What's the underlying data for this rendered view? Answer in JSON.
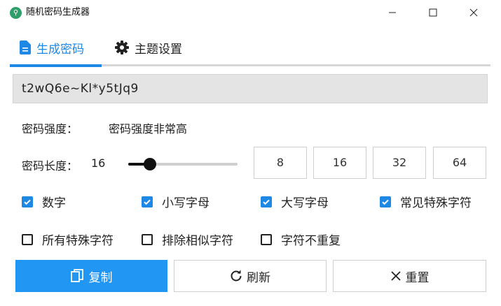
{
  "window": {
    "title": "随机密码生成器",
    "minimize": "—",
    "maximize": "☐",
    "close": "✕"
  },
  "tabs": [
    {
      "label": "生成密码",
      "icon": "document-icon",
      "active": true
    },
    {
      "label": "主题设置",
      "icon": "gear-icon",
      "active": false
    }
  ],
  "password": "t2wQ6e~Kl*y5tJq9",
  "strength": {
    "label": "密码强度：",
    "value": "密码强度非常高"
  },
  "length": {
    "label": "密码长度：",
    "value": "16",
    "slider": {
      "min": 4,
      "max": 64,
      "current": 16
    },
    "presets": [
      "8",
      "16",
      "32",
      "64"
    ]
  },
  "options": [
    {
      "label": "数字",
      "checked": true
    },
    {
      "label": "小写字母",
      "checked": true
    },
    {
      "label": "大写字母",
      "checked": true
    },
    {
      "label": "常见特殊字符",
      "checked": true
    },
    {
      "label": "所有特殊字符",
      "checked": false
    },
    {
      "label": "排除相似字符",
      "checked": false
    },
    {
      "label": "字符不重复",
      "checked": false
    }
  ],
  "actions": {
    "copy": "复制",
    "refresh": "刷新",
    "reset": "重置"
  },
  "colors": {
    "accent": "#1e88e5",
    "primary_button": "#2196f3"
  }
}
